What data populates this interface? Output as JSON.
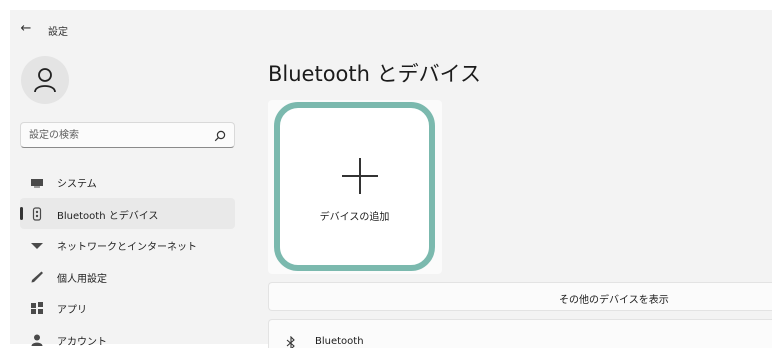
{
  "window": {
    "back_glyph": "←",
    "title": "設定"
  },
  "sidebar": {
    "search_placeholder": "設定の検索",
    "items": [
      {
        "label": "システム",
        "icon": "monitor-icon",
        "active": false
      },
      {
        "label": "Bluetooth とデバイス",
        "icon": "bluetooth-devices-icon",
        "active": true
      },
      {
        "label": "ネットワークとインターネット",
        "icon": "wifi-icon",
        "active": false
      },
      {
        "label": "個人用設定",
        "icon": "pen-icon",
        "active": false
      },
      {
        "label": "アプリ",
        "icon": "apps-icon",
        "active": false
      },
      {
        "label": "アカウント",
        "icon": "account-icon",
        "active": false
      }
    ]
  },
  "main": {
    "title": "Bluetooth とデバイス",
    "add_device_label": "デバイスの追加",
    "show_more_label": "その他のデバイスを表示",
    "bluetooth_label": "Bluetooth"
  },
  "colors": {
    "highlight_border": "#7bb9ae",
    "background": "#f3f3f3",
    "card": "#ffffff"
  }
}
